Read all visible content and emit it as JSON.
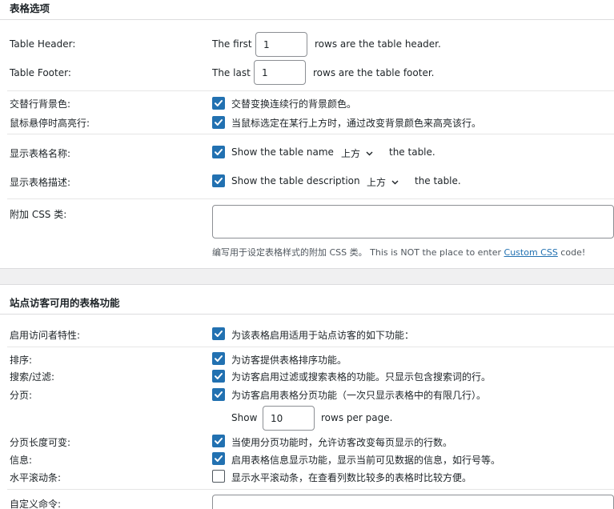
{
  "section1": {
    "title": "表格选项",
    "table_header": {
      "label": "Table Header:",
      "pre": "The first",
      "value": "1",
      "post": "rows are the table header."
    },
    "table_footer": {
      "label": "Table Footer:",
      "pre": "The last",
      "value": "1",
      "post": "rows are the table footer."
    },
    "alternate_bg": {
      "label": "交替行背景色:",
      "text": "交替变换连续行的背景颜色。",
      "checked": true
    },
    "hover_highlight": {
      "label": "鼠标悬停时高亮行:",
      "text": "当鼠标选定在某行上方时，通过改变背景颜色来高亮该行。",
      "checked": true
    },
    "show_name": {
      "label": "显示表格名称:",
      "text": "Show the table name",
      "position": "上方",
      "post": "the table.",
      "checked": true
    },
    "show_desc": {
      "label": "显示表格描述:",
      "text": "Show the table description",
      "position": "上方",
      "post": "the table.",
      "checked": true
    },
    "extra_css": {
      "label": "附加 CSS 类:",
      "value": "",
      "hint_pre": "编写用于设定表格样式的附加 CSS 类。 This is NOT the place to enter ",
      "hint_link": "Custom CSS",
      "hint_post": " code!"
    }
  },
  "section2": {
    "title": "站点访客可用的表格功能",
    "visitor_features": {
      "label": "启用访问者特性:",
      "text": "为该表格启用适用于站点访客的如下功能：",
      "checked": true
    },
    "sorting": {
      "label": "排序:",
      "text": "为访客提供表格排序功能。",
      "checked": true
    },
    "search": {
      "label": "搜索/过滤:",
      "text": "为访客启用过滤或搜索表格的功能。只显示包含搜索词的行。",
      "checked": true
    },
    "pagination": {
      "label": "分页:",
      "text": "为访客启用表格分页功能（一次只显示表格中的有限几行）。",
      "checked": true
    },
    "rows_per_page": {
      "pre": "Show",
      "value": "10",
      "post": "rows per page."
    },
    "page_length": {
      "label": "分页长度可变:",
      "text": "当使用分页功能时，允许访客改变每页显示的行数。",
      "checked": true
    },
    "info": {
      "label": "信息:",
      "text": "启用表格信息显示功能，显示当前可见数据的信息，如行号等。",
      "checked": true
    },
    "horizontal_scroll": {
      "label": "水平滚动条:",
      "text": "显示水平滚动条，在查看列数比较多的表格时比较方便。",
      "checked": false
    },
    "custom_command": {
      "label": "自定义命令:",
      "value": ""
    }
  }
}
